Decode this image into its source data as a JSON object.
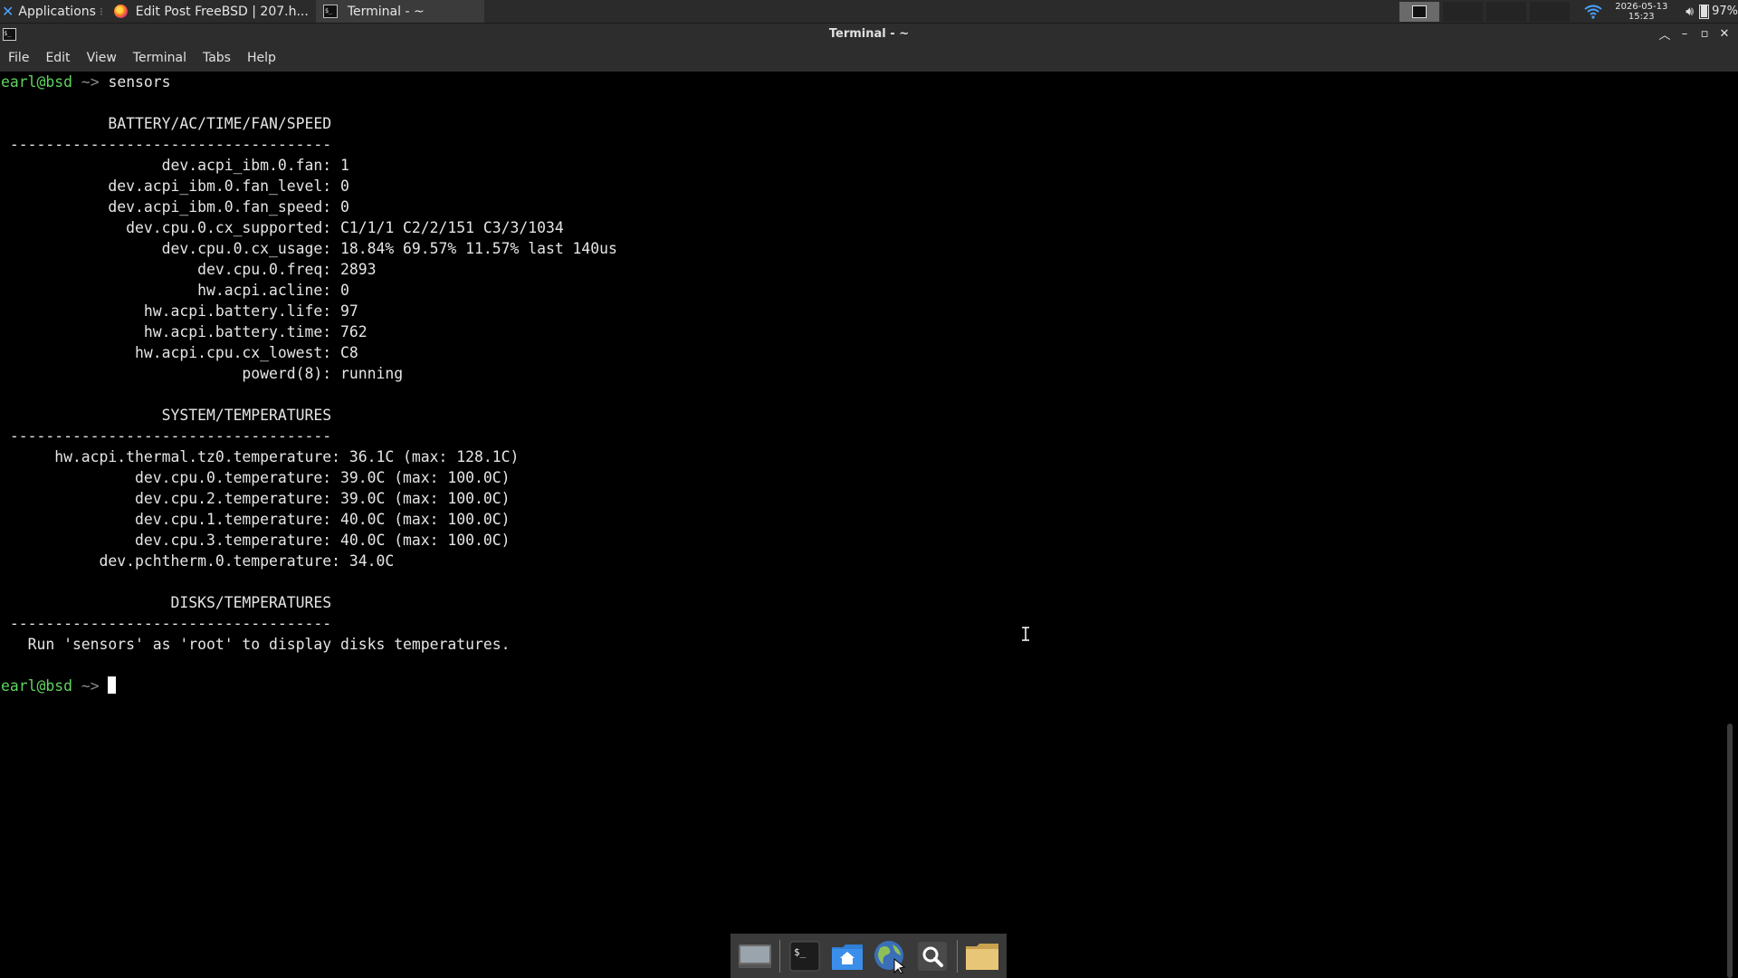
{
  "panel": {
    "applications_label": "Applications",
    "tasks": [
      {
        "label": "Edit Post FreeBSD | 207.h...",
        "icon": "firefox-icon"
      },
      {
        "label": "Terminal - ~",
        "icon": "terminal-icon"
      }
    ],
    "clock_date": "2026-05-13",
    "clock_time": "15:23",
    "battery_percent": "97%",
    "battery_level": 0.97
  },
  "window": {
    "title": "Terminal - ~",
    "menu": [
      "File",
      "Edit",
      "View",
      "Terminal",
      "Tabs",
      "Help"
    ]
  },
  "terminal": {
    "prompt_user": "earl@bsd",
    "prompt_path": "~>",
    "command": "sensors",
    "lines": [
      "",
      "            BATTERY/AC/TIME/FAN/SPEED",
      " ------------------------------------",
      "                  dev.acpi_ibm.0.fan: 1",
      "            dev.acpi_ibm.0.fan_level: 0",
      "            dev.acpi_ibm.0.fan_speed: 0",
      "              dev.cpu.0.cx_supported: C1/1/1 C2/2/151 C3/3/1034",
      "                  dev.cpu.0.cx_usage: 18.84% 69.57% 11.57% last 140us",
      "                      dev.cpu.0.freq: 2893",
      "                      hw.acpi.acline: 0",
      "                hw.acpi.battery.life: 97",
      "                hw.acpi.battery.time: 762",
      "               hw.acpi.cpu.cx_lowest: C8",
      "                           powerd(8): running",
      "",
      "                  SYSTEM/TEMPERATURES",
      " ------------------------------------",
      "      hw.acpi.thermal.tz0.temperature: 36.1C (max: 128.1C)",
      "               dev.cpu.0.temperature: 39.0C (max: 100.0C)",
      "               dev.cpu.2.temperature: 39.0C (max: 100.0C)",
      "               dev.cpu.1.temperature: 40.0C (max: 100.0C)",
      "               dev.cpu.3.temperature: 40.0C (max: 100.0C)",
      "           dev.pchtherm.0.temperature: 34.0C",
      "",
      "                   DISKS/TEMPERATURES",
      " ------------------------------------",
      "   Run 'sensors' as 'root' to display disks temperatures.",
      ""
    ]
  },
  "dock": {
    "items": [
      {
        "icon": "show-desktop-icon"
      },
      {
        "icon": "terminal-icon"
      },
      {
        "icon": "home-folder-icon"
      },
      {
        "icon": "web-browser-icon"
      },
      {
        "icon": "search-icon"
      },
      {
        "icon": "folder-icon"
      }
    ]
  }
}
